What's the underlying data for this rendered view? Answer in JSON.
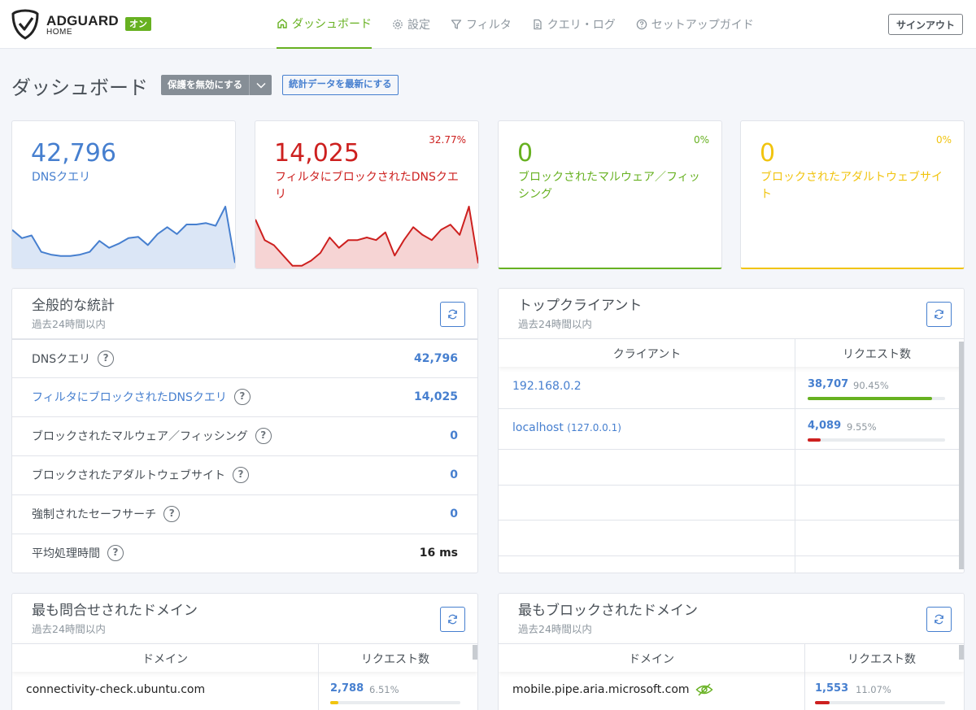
{
  "header": {
    "brand": "ADGUARD",
    "brand_sub": "HOME",
    "status_badge": "オン",
    "nav": [
      {
        "label": "ダッシュボード",
        "icon": "home-icon",
        "active": true
      },
      {
        "label": "設定",
        "icon": "gear-icon",
        "active": false
      },
      {
        "label": "フィルタ",
        "icon": "filter-icon",
        "active": false
      },
      {
        "label": "クエリ・ログ",
        "icon": "document-icon",
        "active": false
      },
      {
        "label": "セットアップガイド",
        "icon": "help-circle-icon",
        "active": false
      }
    ],
    "signout_label": "サインアウト"
  },
  "page": {
    "title": "ダッシュボード",
    "disable_protection_label": "保護を無効にする",
    "refresh_stats_label": "統計データを最新にする"
  },
  "stat_cards": [
    {
      "value": "42,796",
      "label": "DNSクエリ",
      "percent": "",
      "color": "#467fcf",
      "fill": "#dbe6f6",
      "series": [
        14,
        11,
        12,
        6,
        5,
        4.5,
        4.5,
        5,
        6,
        10,
        7.5,
        9,
        11,
        11.5,
        8.5,
        12.5,
        15,
        12.5,
        16,
        16,
        16.5,
        15.5,
        22.5,
        2
      ]
    },
    {
      "value": "14,025",
      "label": "フィルタにブロックされたDNSクエリ",
      "percent": "32.77%",
      "color": "#cd201f",
      "fill": "#f6d4d4",
      "series": [
        19,
        11,
        9,
        5,
        1,
        1,
        3,
        6,
        12,
        8,
        11,
        11,
        12,
        11,
        14,
        5,
        11,
        16,
        13,
        11,
        15,
        17,
        13,
        24,
        2
      ]
    },
    {
      "value": "0",
      "label": "ブロックされたマルウェア／フィッシング",
      "percent": "0%",
      "color": "#67b121",
      "fill": "none",
      "series": []
    },
    {
      "value": "0",
      "label": "ブロックされたアダルトウェブサイト",
      "percent": "0%",
      "color": "#f1c40f",
      "fill": "none",
      "series": []
    }
  ],
  "general_stats": {
    "title": "全般的な統計",
    "subtitle": "過去24時間以内",
    "rows": [
      {
        "label": "DNSクエリ",
        "value": "42,796",
        "link": false,
        "value_dark": false
      },
      {
        "label": "フィルタにブロックされたDNSクエリ",
        "value": "14,025",
        "link": true,
        "value_dark": false
      },
      {
        "label": "ブロックされたマルウェア／フィッシング",
        "value": "0",
        "link": false,
        "value_dark": false
      },
      {
        "label": "ブロックされたアダルトウェブサイト",
        "value": "0",
        "link": false,
        "value_dark": false
      },
      {
        "label": "強制されたセーフサーチ",
        "value": "0",
        "link": false,
        "value_dark": false
      },
      {
        "label": "平均処理時間",
        "value": "16 ms",
        "link": false,
        "value_dark": true
      }
    ]
  },
  "top_clients": {
    "title": "トップクライアント",
    "subtitle": "過去24時間以内",
    "col_client": "クライアント",
    "col_requests": "リクエスト数",
    "rows": [
      {
        "name": "192.168.0.2",
        "extra": "",
        "count": "38,707",
        "percent": "90.45%",
        "fraction": 0.9045,
        "bar_color": "#67b121"
      },
      {
        "name": "localhost",
        "extra": "(127.0.0.1)",
        "count": "4,089",
        "percent": "9.55%",
        "fraction": 0.0955,
        "bar_color": "#cd201f"
      }
    ]
  },
  "top_queried": {
    "title": "最も問合せされたドメイン",
    "subtitle": "過去24時間以内",
    "col_domain": "ドメイン",
    "col_requests": "リクエスト数",
    "rows": [
      {
        "name": "connectivity-check.ubuntu.com",
        "count": "2,788",
        "percent": "6.51%",
        "fraction": 0.0651,
        "bar_color": "#f1c40f"
      }
    ]
  },
  "top_blocked": {
    "title": "最もブロックされたドメイン",
    "subtitle": "過去24時間以内",
    "col_domain": "ドメイン",
    "col_requests": "リクエスト数",
    "rows": [
      {
        "name": "mobile.pipe.aria.microsoft.com",
        "count": "1,553",
        "percent": "11.07%",
        "fraction": 0.1107,
        "bar_color": "#cd201f",
        "icon": "eye-off-icon"
      }
    ]
  }
}
